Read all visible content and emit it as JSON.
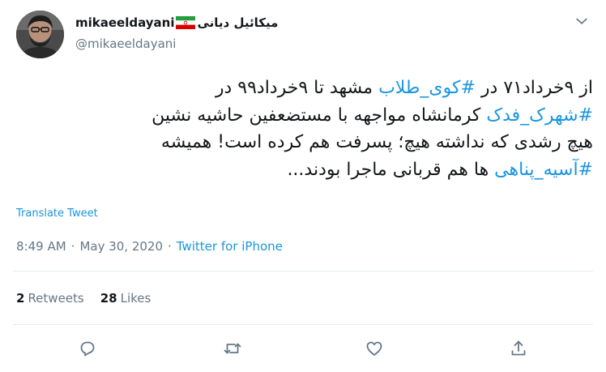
{
  "user": {
    "display_name": "mikaeeldayani",
    "display_name_fa": "میکائیل دیانی",
    "handle": "@mikaeeldayani"
  },
  "icons": {
    "caret": "chevron-down-icon",
    "reply": "reply-icon",
    "retweet": "retweet-icon",
    "like": "heart-icon",
    "share": "share-icon",
    "flag": "iran-flag-icon"
  },
  "tweet": {
    "lines": [
      [
        {
          "text": "از ۹خرداد۷۱ در ",
          "tag": false
        },
        {
          "text": "#کوی_طلاب",
          "tag": true
        },
        {
          "text": " مشهد تا ۹خرداد۹۹ در",
          "tag": false
        }
      ],
      [
        {
          "text": "#شهرک_فدک",
          "tag": true
        },
        {
          "text": " کرمانشاه مواجهه با مستضعفین حاشیه نشین",
          "tag": false
        }
      ],
      [
        {
          "text": "هیچ رشدی که نداشته هیچ؛ پسرفت هم کرده است! همیشه",
          "tag": false
        }
      ],
      [
        {
          "text": "#آسیه_پناهی",
          "tag": true
        },
        {
          "text": " ها هم قربانی ماجرا بودند...",
          "tag": false
        }
      ]
    ],
    "translate_label": "Translate Tweet",
    "time": "8:49 AM",
    "separator": "·",
    "date": "May 30, 2020",
    "source": "Twitter for iPhone"
  },
  "stats": {
    "retweets_count": "2",
    "retweets_label": "Retweets",
    "likes_count": "28",
    "likes_label": "Likes"
  },
  "colors": {
    "link": "#1b95e0",
    "secondary_text": "#657786",
    "primary_text": "#14171a",
    "divider": "#e6ecf0"
  }
}
